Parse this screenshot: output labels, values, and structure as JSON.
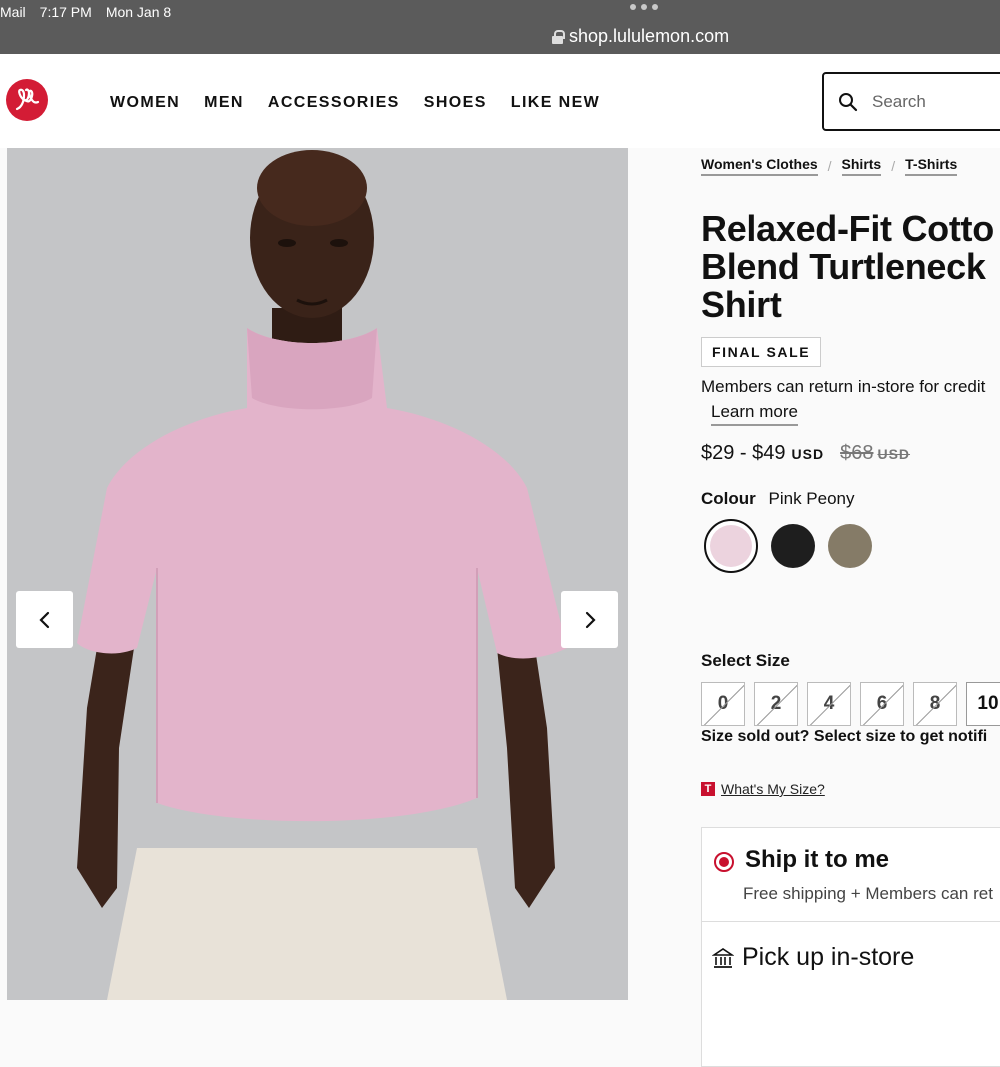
{
  "status_bar": {
    "app": "Mail",
    "time": "7:17 PM",
    "date": "Mon Jan 8"
  },
  "browser": {
    "url": "shop.lululemon.com"
  },
  "nav": {
    "items": [
      "WOMEN",
      "MEN",
      "ACCESSORIES",
      "SHOES",
      "LIKE NEW"
    ]
  },
  "search": {
    "placeholder": "Search"
  },
  "breadcrumb": [
    "Women's Clothes",
    "Shirts",
    "T-Shirts"
  ],
  "product": {
    "title_lines": [
      "Relaxed-Fit Cotto",
      "Blend Turtleneck",
      "Shirt"
    ],
    "badge": "FINAL SALE",
    "members_note": "Members can return in-store for credit",
    "learn_more": "Learn more",
    "price_range": "$29 - $49",
    "price_currency": "USD",
    "original_price": "$68",
    "original_currency": "USD",
    "colour_label": "Colour",
    "colour_value": "Pink Peony",
    "swatches": [
      {
        "name": "Pink Peony",
        "color": "#ecd3de",
        "selected": true
      },
      {
        "name": "Black",
        "color": "#1e1e1e",
        "selected": false
      },
      {
        "name": "Olive",
        "color": "#857b67",
        "selected": false
      }
    ],
    "select_size_label": "Select Size",
    "sizes": [
      {
        "label": "0",
        "sold_out": true
      },
      {
        "label": "2",
        "sold_out": true
      },
      {
        "label": "4",
        "sold_out": true
      },
      {
        "label": "6",
        "sold_out": true
      },
      {
        "label": "8",
        "sold_out": true
      },
      {
        "label": "10",
        "sold_out": false
      }
    ],
    "size_sold_out_note": "Size sold out? Select size to get notifi",
    "whats_my_size": "What's My Size?",
    "whats_my_size_icon_letter": "T",
    "ship_title": "Ship it to me",
    "ship_sub": "Free shipping + Members can ret",
    "pickup": "Pick up in-store"
  },
  "colors": {
    "brand_red": "#d31c35",
    "accent_red": "#c8102e"
  }
}
